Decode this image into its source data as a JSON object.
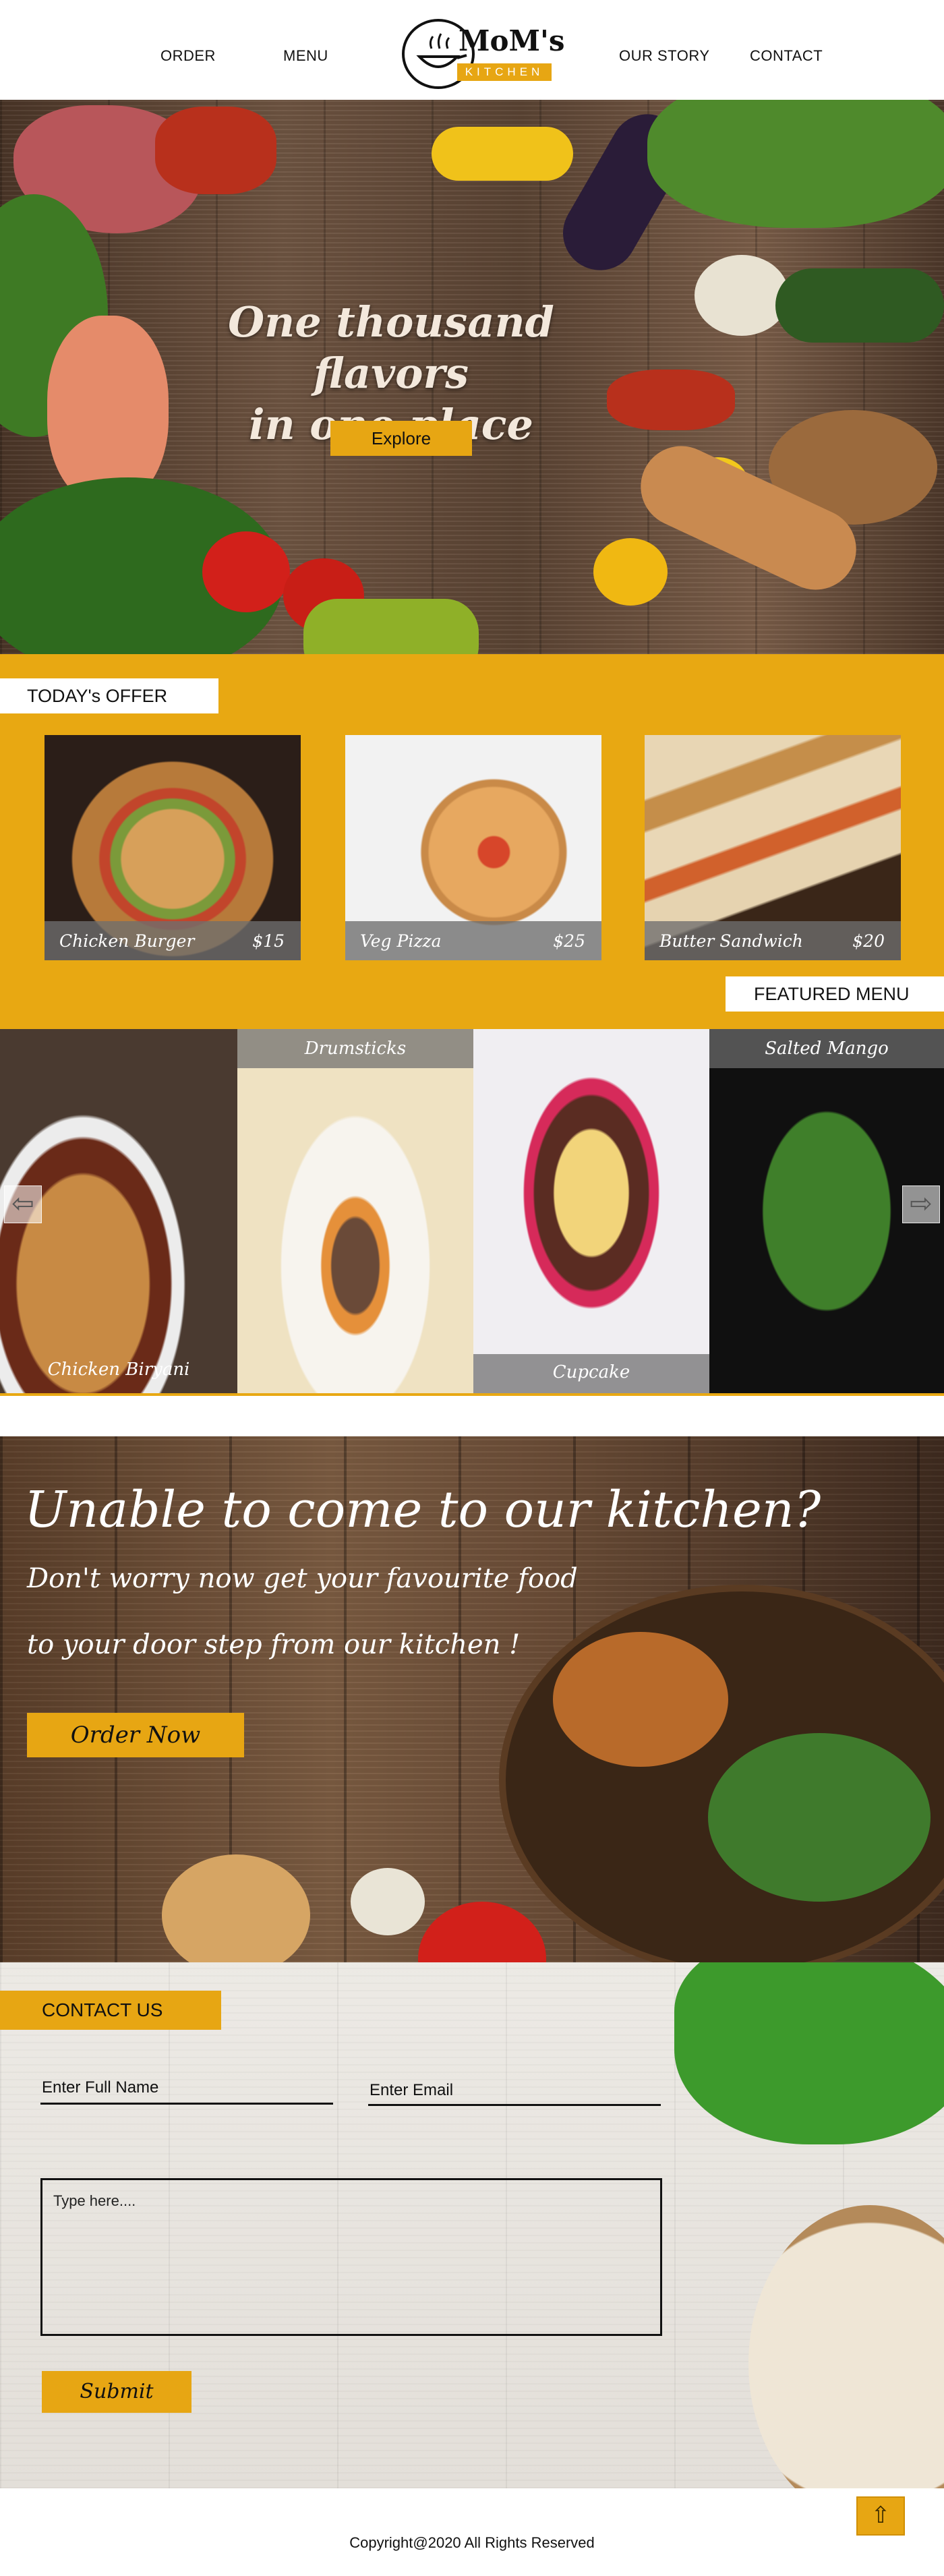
{
  "nav": {
    "order": "ORDER",
    "menu": "MENU",
    "our_story": "OUR STORY",
    "contact": "CONTACT",
    "logo_title": "MoM's",
    "logo_subtitle": "KITCHEN"
  },
  "hero": {
    "title_line1": "One thousand flavors",
    "title_line2": "in one place",
    "explore_label": "Explore"
  },
  "offer": {
    "heading": "TODAY's OFFER",
    "items": [
      {
        "name": "Chicken Burger",
        "price": "$15"
      },
      {
        "name": "Veg Pizza",
        "price": "$25"
      },
      {
        "name": "Butter Sandwich",
        "price": "$20"
      }
    ]
  },
  "featured": {
    "heading": "FEATURED MENU",
    "items": [
      {
        "name": "Chicken Biryani"
      },
      {
        "name": "Drumsticks"
      },
      {
        "name": "Cupcake"
      },
      {
        "name": "Salted Mango"
      }
    ],
    "prev_icon": "arrow-left-icon",
    "next_icon": "arrow-right-icon"
  },
  "delivery": {
    "title": "Unable to come to our kitchen?",
    "line1": "Don't worry now get your favourite food",
    "line2": "to your door step from our kitchen !",
    "order_label": "Order Now"
  },
  "contact": {
    "heading": "CONTACT US",
    "name_label": "Enter Full Name",
    "email_label": "Enter Email",
    "message_placeholder": "Type here....",
    "submit_label": "Submit"
  },
  "footer": {
    "copyright": "Copyright@2020 All Rights Reserved",
    "top_icon": "arrow-up-icon"
  },
  "colors": {
    "accent": "#e7a613",
    "white": "#ffffff",
    "text": "#111111"
  }
}
